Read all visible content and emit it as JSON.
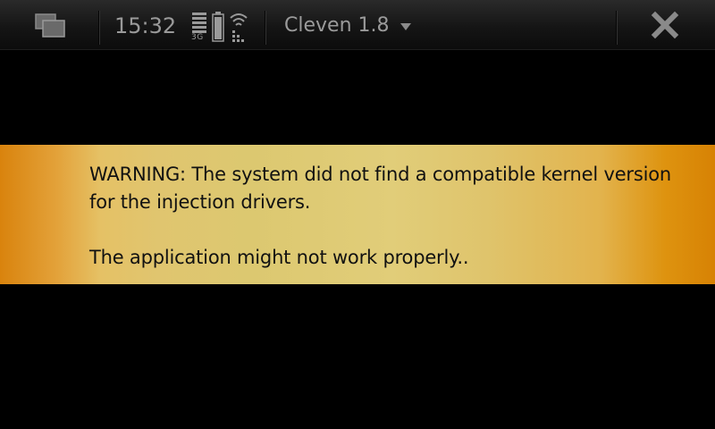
{
  "status_bar": {
    "time": "15:32",
    "network": "3G",
    "app_title": "Cleven 1.8",
    "icons": {
      "task_switcher": "task-switcher-icon",
      "battery": "battery-icon",
      "signal": "signal-icon",
      "wifi": "wifi-icon",
      "dropdown": "chevron-down-icon",
      "close": "close-icon"
    }
  },
  "warning": {
    "line1": "WARNING: The system did not find a compatible kernel version for the injection drivers.",
    "line2": "The application might not work properly.."
  },
  "colors": {
    "banner_edge": "#d9830d",
    "banner_center": "#dcc870",
    "status_text": "#9a9a9a"
  }
}
